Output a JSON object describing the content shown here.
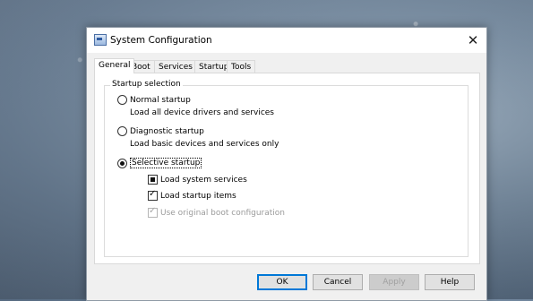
{
  "window": {
    "title": "System Configuration",
    "close_glyph": "✕",
    "icon": "msconfig-icon"
  },
  "tabs": [
    {
      "label": "General",
      "active": true
    },
    {
      "label": "Boot",
      "active": false
    },
    {
      "label": "Services",
      "active": false
    },
    {
      "label": "Startup",
      "active": false
    },
    {
      "label": "Tools",
      "active": false
    }
  ],
  "startup_selection": {
    "group_label": "Startup selection",
    "normal": {
      "label": "Normal startup",
      "description": "Load all device drivers and services",
      "selected": false
    },
    "diagnostic": {
      "label": "Diagnostic startup",
      "description": "Load basic devices and services only",
      "selected": false
    },
    "selective": {
      "label": "Selective startup",
      "selected": true,
      "options": {
        "system_services": {
          "label": "Load system services",
          "state": "indeterminate"
        },
        "startup_items": {
          "label": "Load startup items",
          "state": "checked"
        },
        "boot_config": {
          "label": "Use original boot configuration",
          "state": "checked",
          "enabled": false
        }
      }
    }
  },
  "buttons": {
    "ok": "OK",
    "cancel": "Cancel",
    "apply": "Apply",
    "help": "Help"
  },
  "colors": {
    "accent": "#0078d7",
    "window_bg": "#f0f0f0",
    "panel_bg": "#ffffff"
  }
}
